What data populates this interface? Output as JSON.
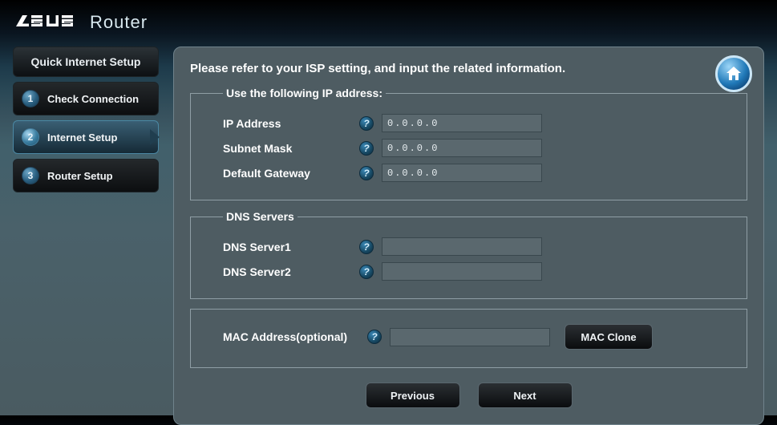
{
  "header": {
    "title": "Router"
  },
  "sidebar": {
    "title": "Quick Internet Setup",
    "steps": [
      {
        "num": "1",
        "label": "Check Connection"
      },
      {
        "num": "2",
        "label": "Internet Setup"
      },
      {
        "num": "3",
        "label": "Router Setup"
      }
    ]
  },
  "instruction": "Please refer to your ISP setting, and input the related information.",
  "group_ip": {
    "legend": "Use the following IP address:",
    "ip_label": "IP Address",
    "ip_value": "0.0.0.0",
    "mask_label": "Subnet Mask",
    "mask_value": "0.0.0.0",
    "gw_label": "Default Gateway",
    "gw_value": "0.0.0.0"
  },
  "group_dns": {
    "legend": "DNS Servers",
    "dns1_label": "DNS Server1",
    "dns1_value": "",
    "dns2_label": "DNS Server2",
    "dns2_value": ""
  },
  "group_mac": {
    "label": "MAC Address(optional)",
    "value": "",
    "clone_label": "MAC Clone"
  },
  "buttons": {
    "prev": "Previous",
    "next": "Next"
  }
}
